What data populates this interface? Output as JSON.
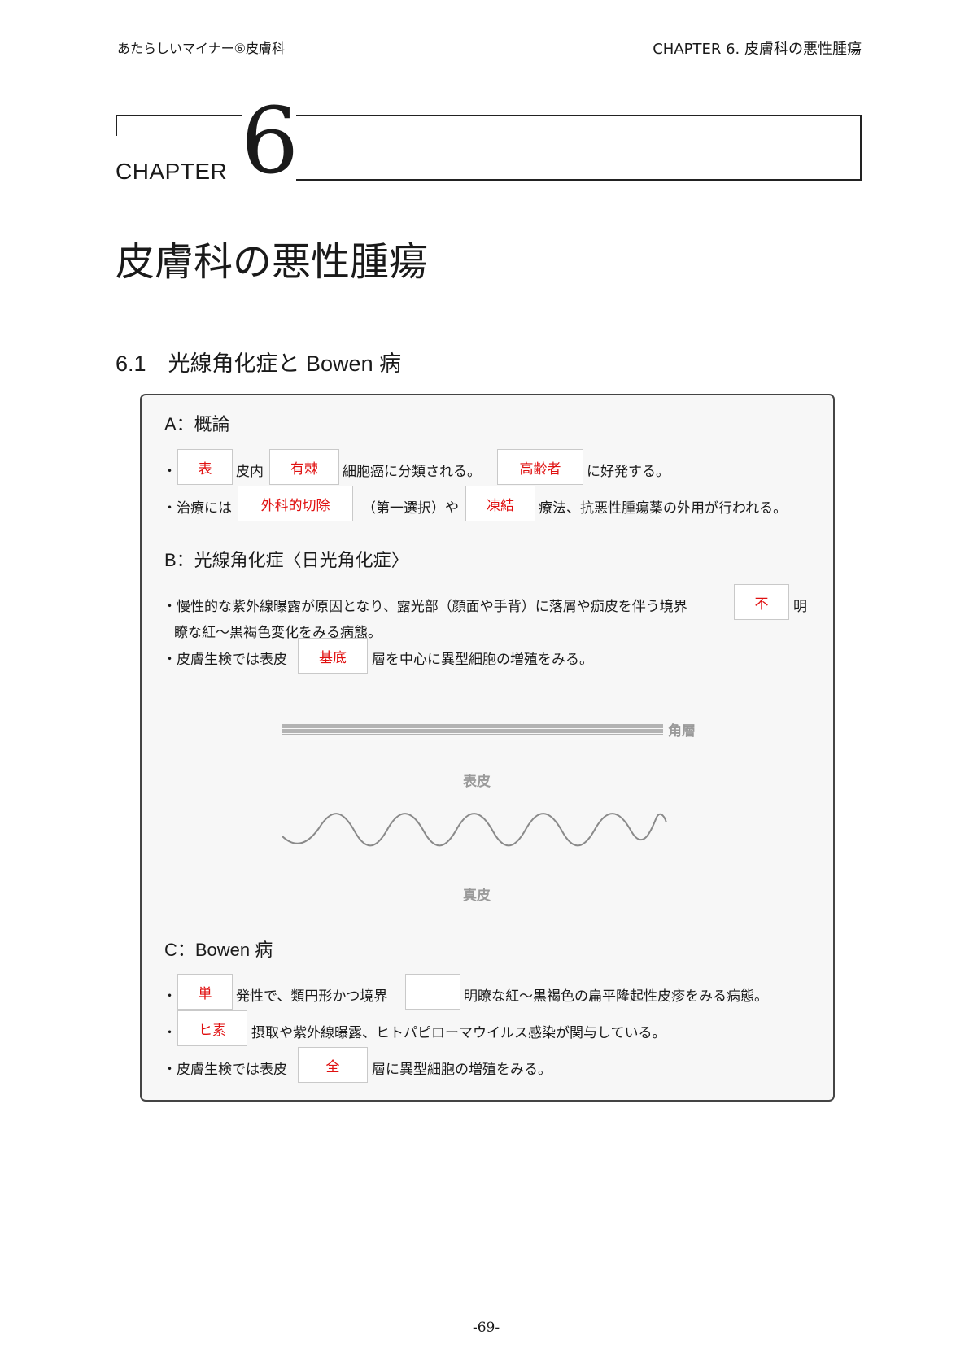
{
  "header": {
    "left": "あたらしいマイナー⑥皮膚科",
    "right": "CHAPTER  6.  皮膚科の悪性腫瘍"
  },
  "chapter": {
    "word": "CHAPTER",
    "number": "6",
    "title": "皮膚科の悪性腫瘍"
  },
  "section": {
    "title": "6.1　光線角化症と Bowen 病"
  },
  "panel": {
    "A": {
      "heading": "A：概論",
      "l1_bullet": "・",
      "l1_box1": "表",
      "l1_t1": "皮内",
      "l1_box2": "有棘",
      "l1_t2": "細胞癌に分類される。",
      "l1_box3": "高齢者",
      "l1_t3": "に好発する。",
      "l2_t1": "・治療には",
      "l2_box1": "外科的切除",
      "l2_t2": "（第一選択）や",
      "l2_box2": "凍結",
      "l2_t3": "療法、抗悪性腫瘍薬の外用が行われる。"
    },
    "B": {
      "heading": "B：光線角化症〈日光角化症〉",
      "l1_t1": "・慢性的な紫外線曝露が原因となり、露光部（顔面や手背）に落屑や痂皮を伴う境界",
      "l1_box1": "不",
      "l1_t2": "明",
      "l1_cont": "瞭な紅〜黒褐色変化をみる病態。",
      "l2_t1": "・皮膚生検では表皮",
      "l2_box1": "基底",
      "l2_t2": "層を中心に異型細胞の増殖をみる。",
      "diagram": {
        "stratum_corneum": "角層",
        "epidermis": "表皮",
        "dermis": "真皮"
      }
    },
    "C": {
      "heading": "C：Bowen 病",
      "l1_bullet": "・",
      "l1_box1": "単",
      "l1_t1": "発性で、類円形かつ境界",
      "l1_box2": "",
      "l1_t2": "明瞭な紅〜黒褐色の扁平隆起性皮疹をみる病態。",
      "l2_bullet": "・",
      "l2_box1": "ヒ素",
      "l2_t1": "摂取や紫外線曝露、ヒトパピローマウイルス感染が関与している。",
      "l3_t1": "・皮膚生検では表皮",
      "l3_box1": "全",
      "l3_t2": "層に異型細胞の増殖をみる。"
    }
  },
  "footer": {
    "page": "-69-"
  }
}
